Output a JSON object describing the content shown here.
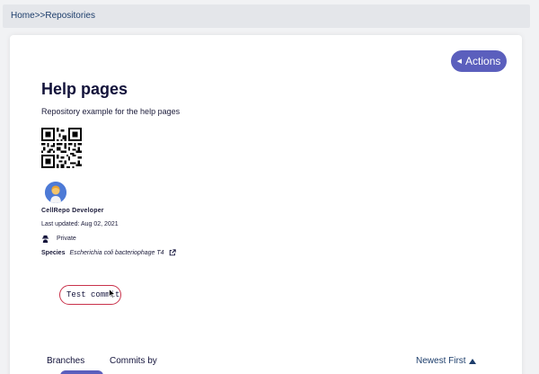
{
  "breadcrumb": {
    "home": "Home",
    "separator": ">>",
    "current": "Repositories"
  },
  "header": {
    "actions_label": "Actions"
  },
  "repo": {
    "title": "Help pages",
    "description": "Repository example for the help pages",
    "owner": "CellRepo Developer",
    "last_updated": "Last updated: Aug 02, 2021",
    "visibility": "Private",
    "species_label": "Species",
    "species_value": "Escherichia coli bacteriophage T4"
  },
  "commit_input": {
    "value": "Test commit"
  },
  "tabs": [
    {
      "label": "Branches"
    },
    {
      "label": "Commits by"
    }
  ],
  "sort": {
    "label": "Newest First"
  },
  "colors": {
    "accent": "#5b5fbd",
    "commit_border": "#c9324b",
    "link": "#1c3d6b"
  },
  "icons": {
    "actions": "caret-left-icon",
    "visibility": "spy-icon",
    "species_link": "external-link-icon",
    "sort": "caret-up-icon"
  }
}
